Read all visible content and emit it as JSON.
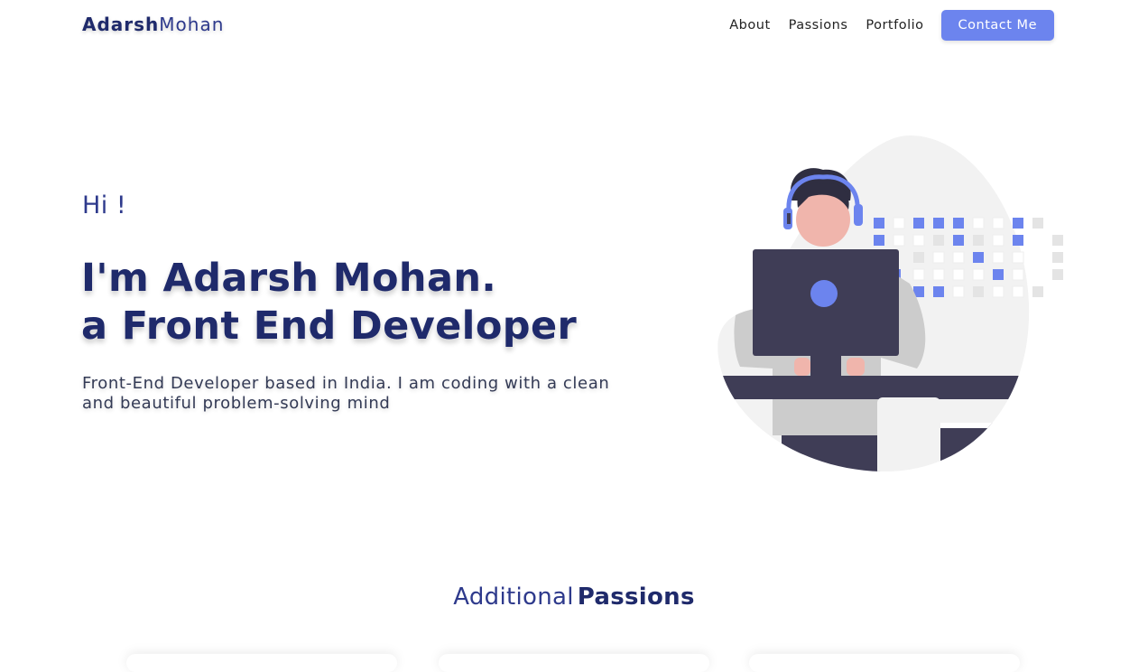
{
  "logo": {
    "bold": "Adarsh",
    "light": "Mohan"
  },
  "nav": {
    "links": [
      "About",
      "Passions",
      "Portfolio"
    ],
    "contact_label": "Contact Me"
  },
  "hero": {
    "greeting": "Hi !",
    "headline_line1": "I'm Adarsh Mohan.",
    "headline_line2": "a Front End Developer",
    "intro": "Front-End Developer based in India. I am coding with a clean and beautiful problem-solving mind",
    "illustration": "developer-at-computer-illustration"
  },
  "passions": {
    "title_light": "Additional",
    "title_bold": "Passions"
  },
  "colors": {
    "accent": "#6c84ee",
    "navy": "#1f2a6b",
    "text": "#333a55"
  }
}
